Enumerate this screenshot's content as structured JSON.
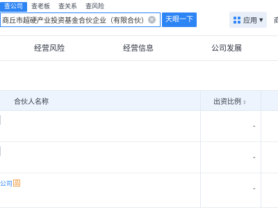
{
  "header": {
    "tabs": [
      "查公司",
      "查老板",
      "查关系",
      "查风险"
    ],
    "search_value": "商丘市超硬产业投资基金合伙企业（有限合伙）",
    "search_button": "天眼一下",
    "app_label": "应用",
    "right_text": "商"
  },
  "nav": {
    "items": [
      "经营风险",
      "经营信息",
      "公司发展"
    ]
  },
  "table": {
    "columns": [
      "合伙人名称",
      "出资比例"
    ],
    "rows": [
      {
        "name": "",
        "ratio": "-"
      },
      {
        "name": "",
        "ratio": "-"
      },
      {
        "name": "公司",
        "ratio": "-",
        "badge": "品"
      }
    ]
  },
  "colors": {
    "accent": "#2d84f5"
  }
}
